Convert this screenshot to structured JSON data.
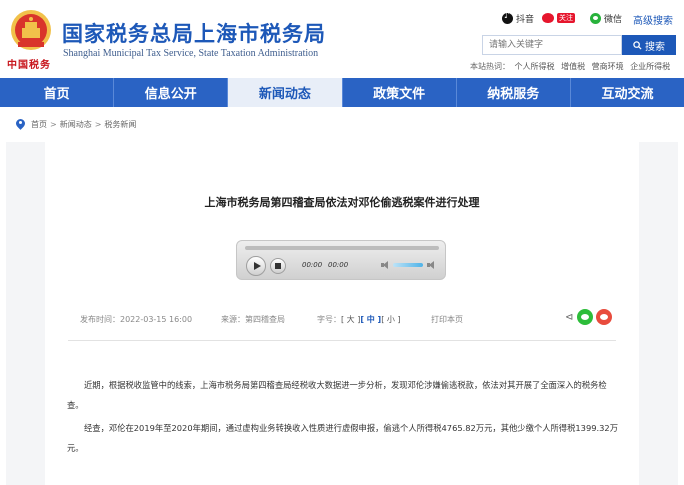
{
  "header": {
    "emblem_text": "中国税务",
    "title": "国家税务总局上海市税务局",
    "subtitle": "Shanghai Municipal Tax Service, State Taxation Administration",
    "social": [
      {
        "icon": "douyin-icon",
        "label": "抖音"
      },
      {
        "icon": "weibo-icon",
        "label": "关注"
      },
      {
        "icon": "wechat-icon",
        "label": "微信"
      }
    ],
    "advanced_search": "高级搜索",
    "search": {
      "placeholder": "请输入关键字",
      "button": "搜索"
    },
    "hot_label": "本站热词：",
    "hot_words": [
      "个人所得税",
      "增值税",
      "营商环境",
      "企业所得税"
    ]
  },
  "nav": [
    "首页",
    "信息公开",
    "新闻动态",
    "政策文件",
    "纳税服务",
    "互动交流"
  ],
  "breadcrumb": {
    "home": "首页",
    "sep": ">",
    "level1": "新闻动态",
    "level2": "税务新闻"
  },
  "article": {
    "title": "上海市税务局第四稽查局依法对邓伦偷逃税案件进行处理",
    "player": {
      "current": "00:00",
      "duration": "00:00"
    },
    "meta": {
      "date": "发布时间：2022-03-15 16:00",
      "source": "来源：第四稽查局",
      "font_label": "字号：",
      "font_large": "[ 大 ]",
      "font_medium": "[ 中 ]",
      "font_small": "[ 小 ]",
      "print": "打印本页"
    },
    "paragraphs": [
      "近期，根据税收监管中的线索，上海市税务局第四稽查局经税收大数据进一步分析，发现邓伦涉嫌偷逃税款，依法对其开展了全面深入的税务检查。",
      "经查，邓伦在2019年至2020年期间，通过虚构业务转换收入性质进行虚假申报，偷逃个人所得税4765.82万元，其他少缴个人所得税1399.32万元。"
    ]
  },
  "colors": {
    "brand_blue": "#1d58b8",
    "nav_blue": "#2a63c4",
    "accent_red": "#c8161d"
  }
}
